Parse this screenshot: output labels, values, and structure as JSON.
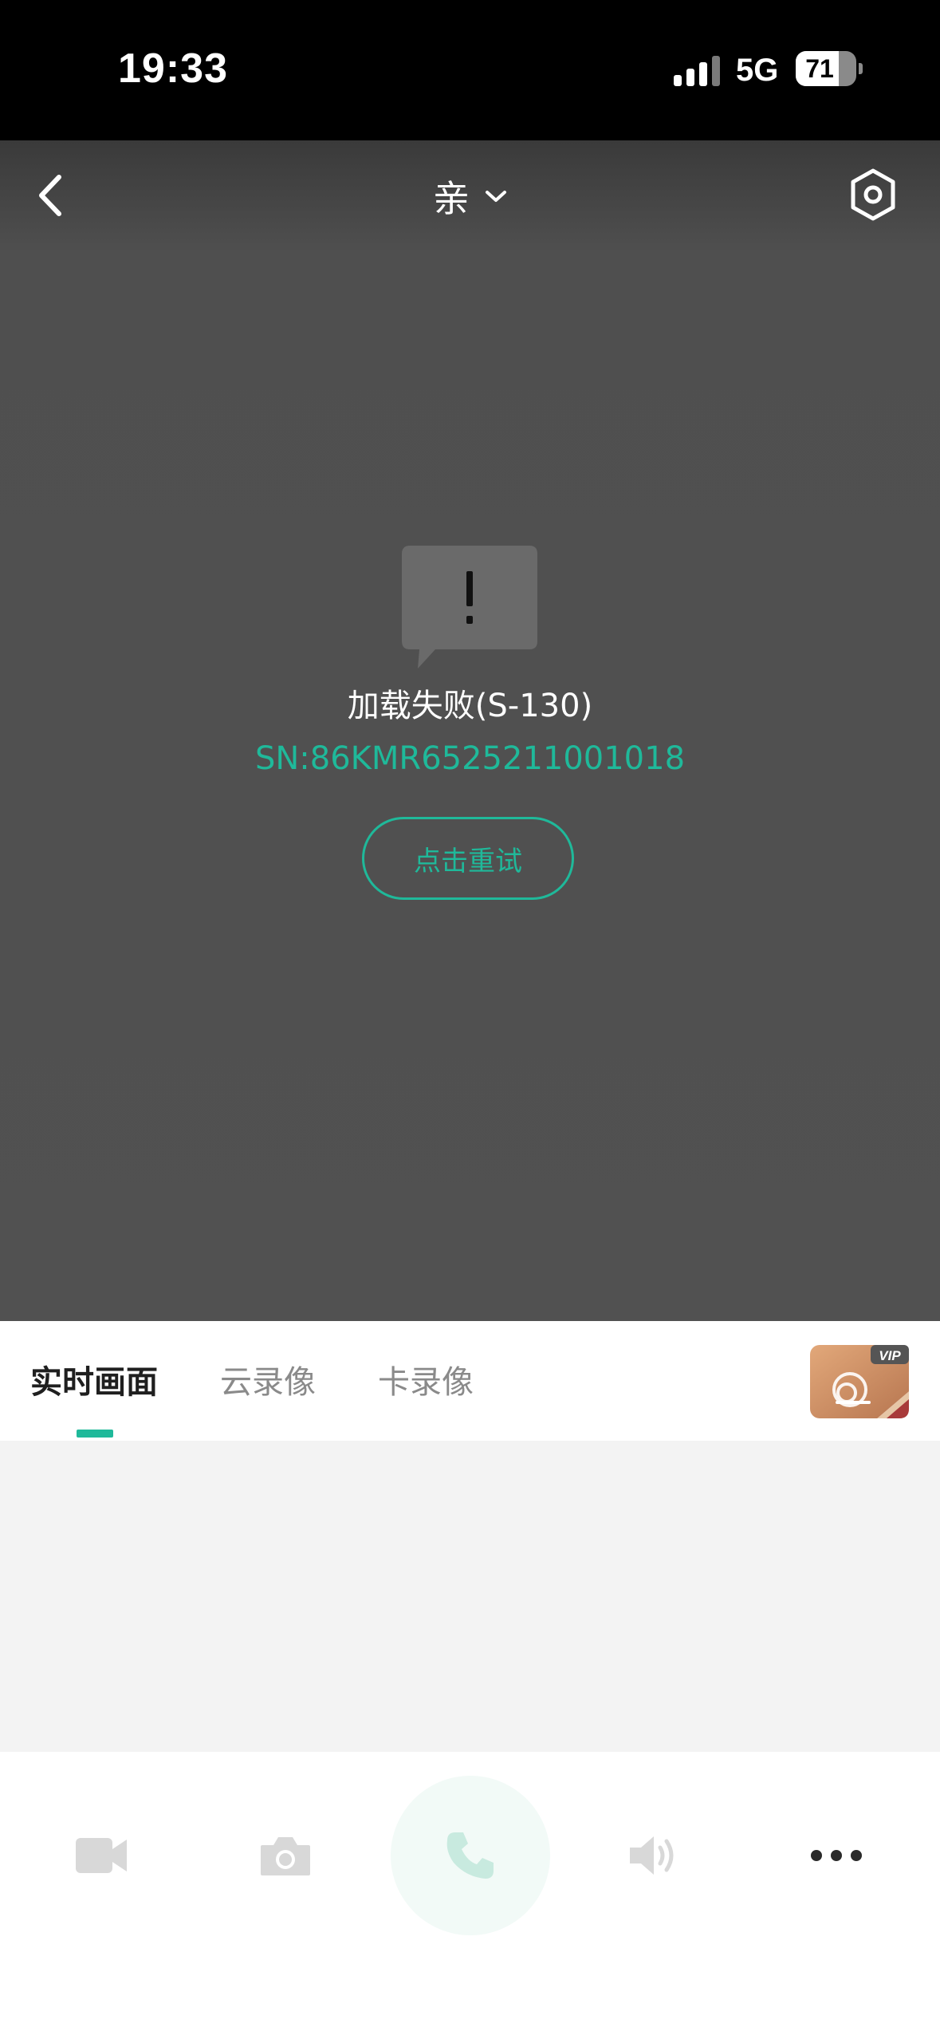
{
  "status_bar": {
    "time": "19:33",
    "network": "5G",
    "battery_percent": 71,
    "battery_label": "71"
  },
  "header": {
    "title": "亲",
    "icons": {
      "back": "chevron-left-icon",
      "dropdown": "chevron-down-icon",
      "settings": "hexagon-gear-icon"
    }
  },
  "player": {
    "error_message": "加载失败(S-130)",
    "serial": "SN:86KMR6525211001018",
    "retry_label": "点击重试",
    "error_icon": "alert-bubble-icon"
  },
  "tabs": [
    {
      "label": "实时画面",
      "active": true
    },
    {
      "label": "云录像",
      "active": false
    },
    {
      "label": "卡录像",
      "active": false
    }
  ],
  "vip_badge": {
    "label": "VIP",
    "icon": "cloud-vip-icon"
  },
  "toolbar": [
    {
      "icon": "video-camera-icon",
      "enabled": false
    },
    {
      "icon": "camera-icon",
      "enabled": false
    },
    {
      "icon": "phone-icon",
      "enabled": false
    },
    {
      "icon": "speaker-icon",
      "enabled": false
    },
    {
      "icon": "more-icon",
      "enabled": true
    }
  ],
  "colors": {
    "accent": "#1fb99a",
    "video_bg": "#515151",
    "status_bar": "#000000",
    "content_bg": "#f3f3f3",
    "disabled_icon": "#d8d8d8",
    "call_circle": "#f2faf7"
  }
}
